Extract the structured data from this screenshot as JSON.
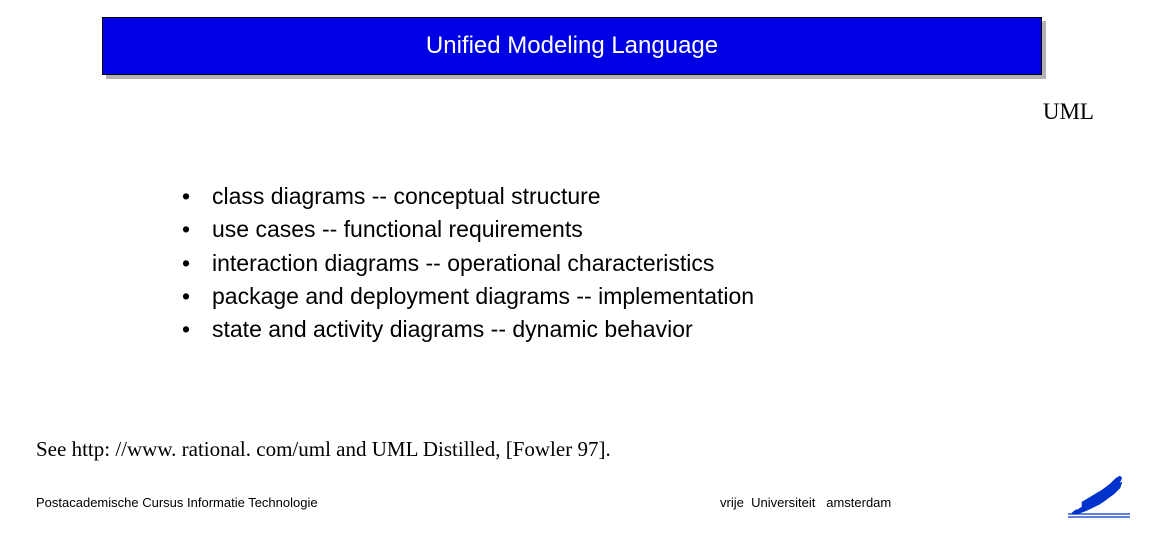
{
  "header": {
    "title": "Unified Modeling Language"
  },
  "subtitle": "UML",
  "bullets": {
    "item0": "class diagrams -- conceptual structure",
    "item1": "use cases -- functional requirements",
    "item2": "interaction diagrams -- operational characteristics",
    "item3": "package and deployment diagrams -- implementation",
    "item4": "state and activity diagrams -- dynamic behavior"
  },
  "reference": "See http: //www. rational. com/uml and UML Distilled,  [Fowler 97].",
  "footer": {
    "left": "Postacademische Cursus Informatie Technologie",
    "center_part1": "vrije",
    "center_part2": "Universiteit",
    "center_part3": "amsterdam"
  }
}
